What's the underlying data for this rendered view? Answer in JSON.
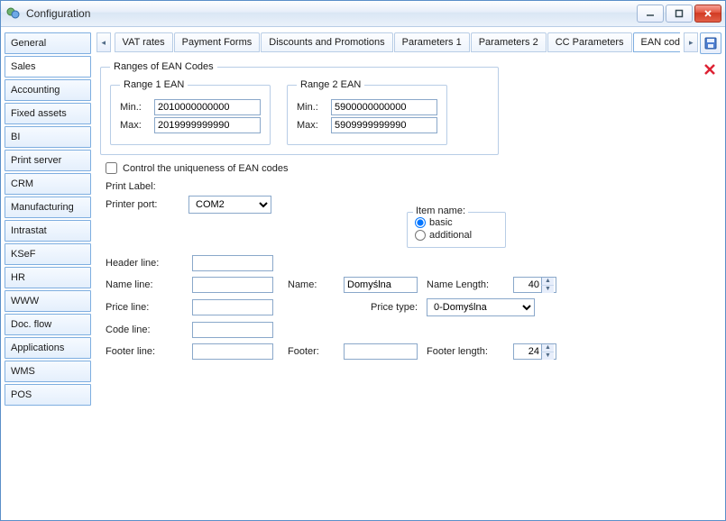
{
  "window": {
    "title": "Configuration"
  },
  "sidebar": {
    "items": [
      {
        "label": "General"
      },
      {
        "label": "Sales",
        "active": true
      },
      {
        "label": "Accounting"
      },
      {
        "label": "Fixed assets"
      },
      {
        "label": "BI"
      },
      {
        "label": "Print server"
      },
      {
        "label": "CRM"
      },
      {
        "label": "Manufacturing"
      },
      {
        "label": "Intrastat"
      },
      {
        "label": "KSeF"
      },
      {
        "label": "HR"
      },
      {
        "label": "WWW"
      },
      {
        "label": "Doc. flow"
      },
      {
        "label": "Applications"
      },
      {
        "label": "WMS"
      },
      {
        "label": "POS"
      }
    ]
  },
  "tabs": {
    "scroll_left": "◂",
    "scroll_right": "▸",
    "items": [
      {
        "label": "VAT rates"
      },
      {
        "label": "Payment Forms"
      },
      {
        "label": "Discounts and Promotions"
      },
      {
        "label": "Parameters 1"
      },
      {
        "label": "Parameters 2"
      },
      {
        "label": "CC Parameters"
      },
      {
        "label": "EAN codes",
        "active": true
      }
    ]
  },
  "ean": {
    "group_title": "Ranges of EAN Codes",
    "range1_title": "Range 1 EAN",
    "range2_title": "Range 2 EAN",
    "min_label": "Min.:",
    "max_label": "Max:",
    "range1_min": "2010000000000",
    "range1_max": "2019999999990",
    "range2_min": "5900000000000",
    "range2_max": "5909999999990",
    "uniqueness_label": "Control the uniqueness of EAN codes",
    "uniqueness_checked": false
  },
  "print": {
    "section_title": "Print Label:",
    "printer_port_label": "Printer port:",
    "printer_port_value": "COM2",
    "item_name_legend": "Item name:",
    "item_name_basic": "basic",
    "item_name_additional": "additional",
    "item_name_selected": "basic",
    "header_line_label": "Header line:",
    "header_line_value": "",
    "name_line_label": "Name line:",
    "name_line_value": "",
    "name_label": "Name:",
    "name_value": "Domyślna",
    "name_length_label": "Name Length:",
    "name_length_value": "40",
    "price_line_label": "Price line:",
    "price_line_value": "",
    "price_type_label": "Price type:",
    "price_type_value": "0-Domyślna",
    "code_line_label": "Code line:",
    "code_line_value": "",
    "footer_line_label": "Footer line:",
    "footer_line_value": "",
    "footer_label": "Footer:",
    "footer_value": "",
    "footer_length_label": "Footer length:",
    "footer_length_value": "24"
  }
}
